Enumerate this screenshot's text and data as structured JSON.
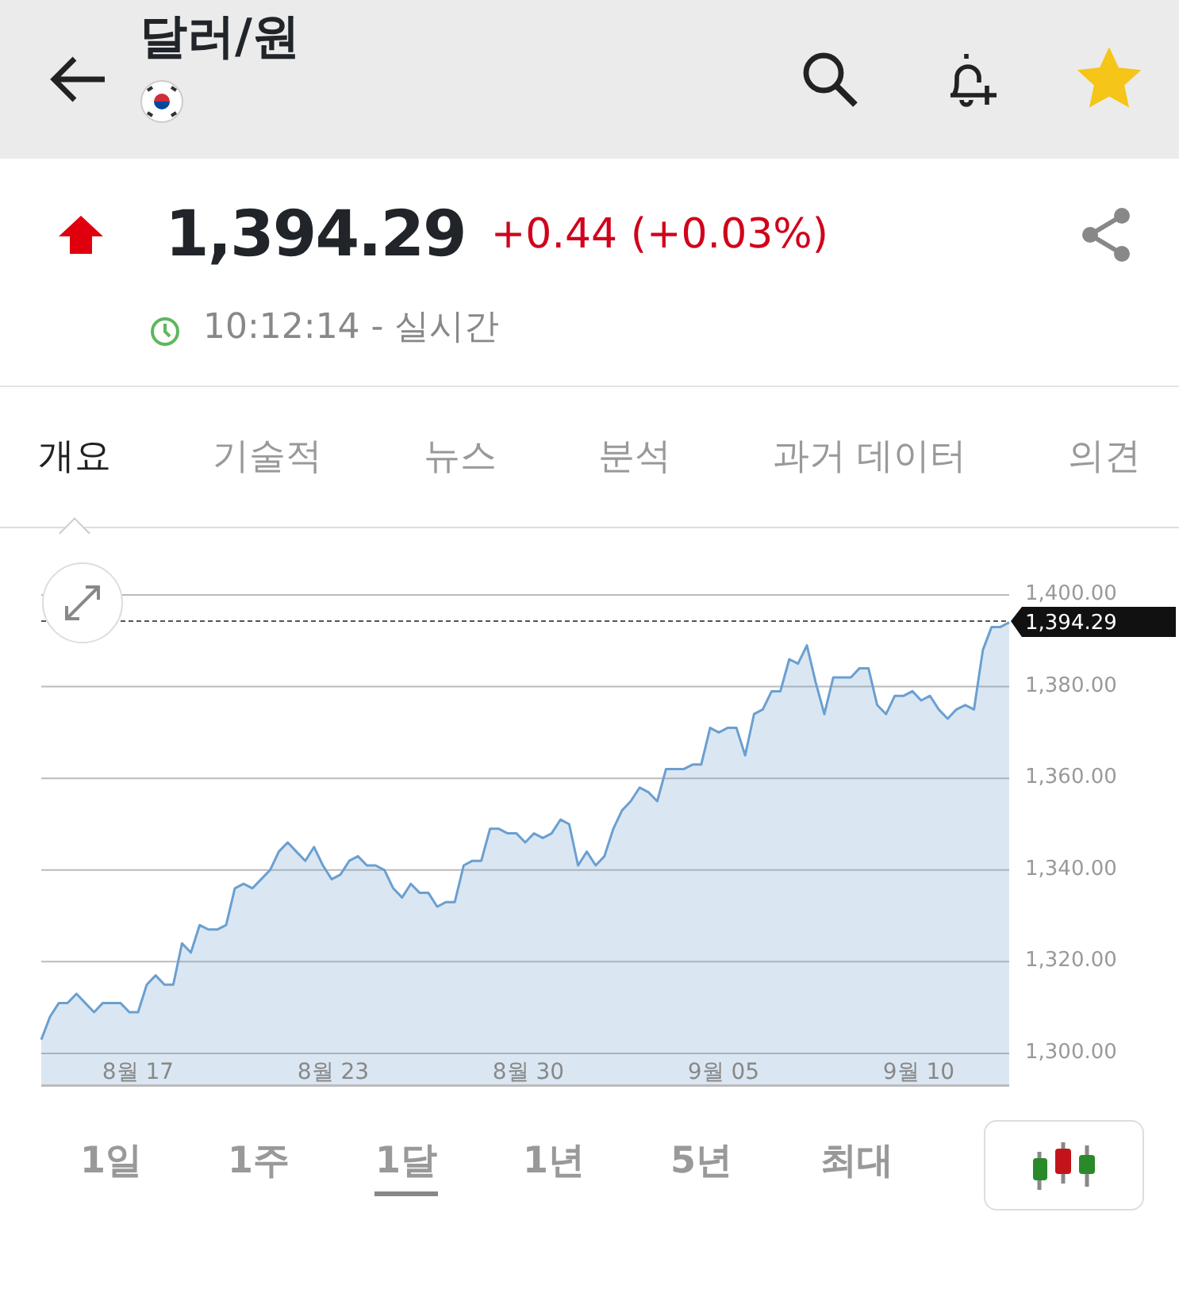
{
  "header": {
    "title": "달러/원",
    "favorite": true
  },
  "quote": {
    "rising": true,
    "price": "1,394.29",
    "change": "+0.44 (+0.03%)",
    "time": "10:12:14 - 실시간"
  },
  "tabs": [
    {
      "label": "개요",
      "selected": true
    },
    {
      "label": "기술적",
      "selected": false
    },
    {
      "label": "뉴스",
      "selected": false
    },
    {
      "label": "분석",
      "selected": false
    },
    {
      "label": "과거 데이터",
      "selected": false
    },
    {
      "label": "의견",
      "selected": false
    }
  ],
  "chart": {
    "x_labels": [
      "8월 17",
      "8월 23",
      "8월 30",
      "9월 05",
      "9월 10"
    ],
    "chart_data": {
      "type": "area",
      "grid": true,
      "ylim": [
        1293,
        1400
      ],
      "ref_lines": [
        {
          "axis": "y",
          "value": 1394.29,
          "label": "1,394.29"
        }
      ],
      "yticks": [
        {
          "value": 1300,
          "label": "1,300.00"
        },
        {
          "value": 1320,
          "label": "1,320.00"
        },
        {
          "value": 1340,
          "label": "1,340.00"
        },
        {
          "value": 1360,
          "label": "1,360.00"
        },
        {
          "value": 1380,
          "label": "1,380.00"
        },
        {
          "value": 1400,
          "label": "1,400.00"
        }
      ],
      "series": [
        {
          "color": "#6b9fd0",
          "values": [
            1303,
            1308,
            1311,
            1311,
            1313,
            1311,
            1309,
            1311,
            1311,
            1311,
            1309,
            1309,
            1315,
            1317,
            1315,
            1315,
            1324,
            1322,
            1328,
            1327,
            1327,
            1328,
            1336,
            1337,
            1336,
            1338,
            1340,
            1344,
            1346,
            1344,
            1342,
            1345,
            1341,
            1338,
            1339,
            1342,
            1343,
            1341,
            1341,
            1340,
            1336,
            1334,
            1337,
            1335,
            1335,
            1332,
            1333,
            1333,
            1341,
            1342,
            1342,
            1349,
            1349,
            1348,
            1348,
            1346,
            1348,
            1347,
            1348,
            1351,
            1350,
            1341,
            1344,
            1341,
            1343,
            1349,
            1353,
            1355,
            1358,
            1357,
            1355,
            1362,
            1362,
            1362,
            1363,
            1363,
            1371,
            1370,
            1371,
            1371,
            1365,
            1374,
            1375,
            1379,
            1379,
            1386,
            1385,
            1389,
            1381,
            1374,
            1382,
            1382,
            1382,
            1384,
            1384,
            1376,
            1374,
            1378,
            1378,
            1379,
            1377,
            1378,
            1375,
            1373,
            1375,
            1376,
            1375,
            1388,
            1393,
            1393,
            1394
          ]
        }
      ]
    }
  },
  "ranges": [
    {
      "label": "1일",
      "selected": false
    },
    {
      "label": "1주",
      "selected": false
    },
    {
      "label": "1달",
      "selected": true
    },
    {
      "label": "1년",
      "selected": false
    },
    {
      "label": "5년",
      "selected": false
    },
    {
      "label": "최대",
      "selected": false
    }
  ]
}
